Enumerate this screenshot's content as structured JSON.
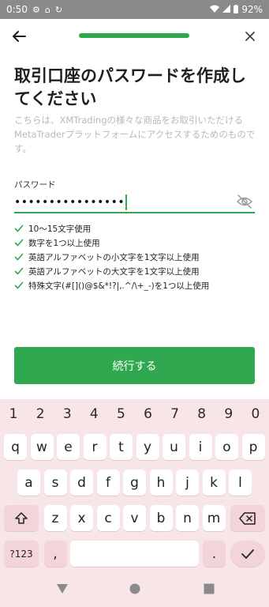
{
  "status_bar": {
    "time": "0:50",
    "battery": "92%",
    "left_icons": [
      "gear-icon",
      "home-icon",
      "sync-icon"
    ],
    "right_icons": [
      "wifi-icon",
      "signal-icon",
      "battery-icon"
    ]
  },
  "header": {
    "back_icon": "arrow-left-icon",
    "close_icon": "close-icon",
    "progress": 1.0
  },
  "page": {
    "title": "取引口座のパスワードを作成してください",
    "subtitle": "こちらは、XMTradingの様々な商品をお取引いただけるMetaTraderプラットフォームにアクセスするためのものです。"
  },
  "password": {
    "label": "パスワード",
    "value": "••••••••••••••••",
    "toggle_icon": "eye-off-icon"
  },
  "requirements": [
    {
      "text": "10〜15文字使用",
      "met": true
    },
    {
      "text": "数字を1つ以上使用",
      "met": true
    },
    {
      "text": "英語アルファベットの小文字を1文字以上使用",
      "met": true
    },
    {
      "text": "英語アルファベットの大文字を1文字以上使用",
      "met": true
    },
    {
      "text": "特殊文字(#[]()@$&*!?|,.^/\\+_-)を1つ以上使用",
      "met": true
    }
  ],
  "continue_button": "続行する",
  "keyboard": {
    "numbers": [
      "1",
      "2",
      "3",
      "4",
      "5",
      "6",
      "7",
      "8",
      "9",
      "0"
    ],
    "row1": [
      "q",
      "w",
      "e",
      "r",
      "t",
      "y",
      "u",
      "i",
      "o",
      "p"
    ],
    "row2": [
      "a",
      "s",
      "d",
      "f",
      "g",
      "h",
      "j",
      "k",
      "l"
    ],
    "row3": [
      "z",
      "x",
      "c",
      "v",
      "b",
      "n",
      "m"
    ],
    "symbols_key": "?123",
    "comma_key": ",",
    "period_key": "."
  },
  "colors": {
    "accent": "#2fa84f",
    "keyboard_bg": "#f8e5e7",
    "subtitle_text": "#b9b9b9"
  }
}
